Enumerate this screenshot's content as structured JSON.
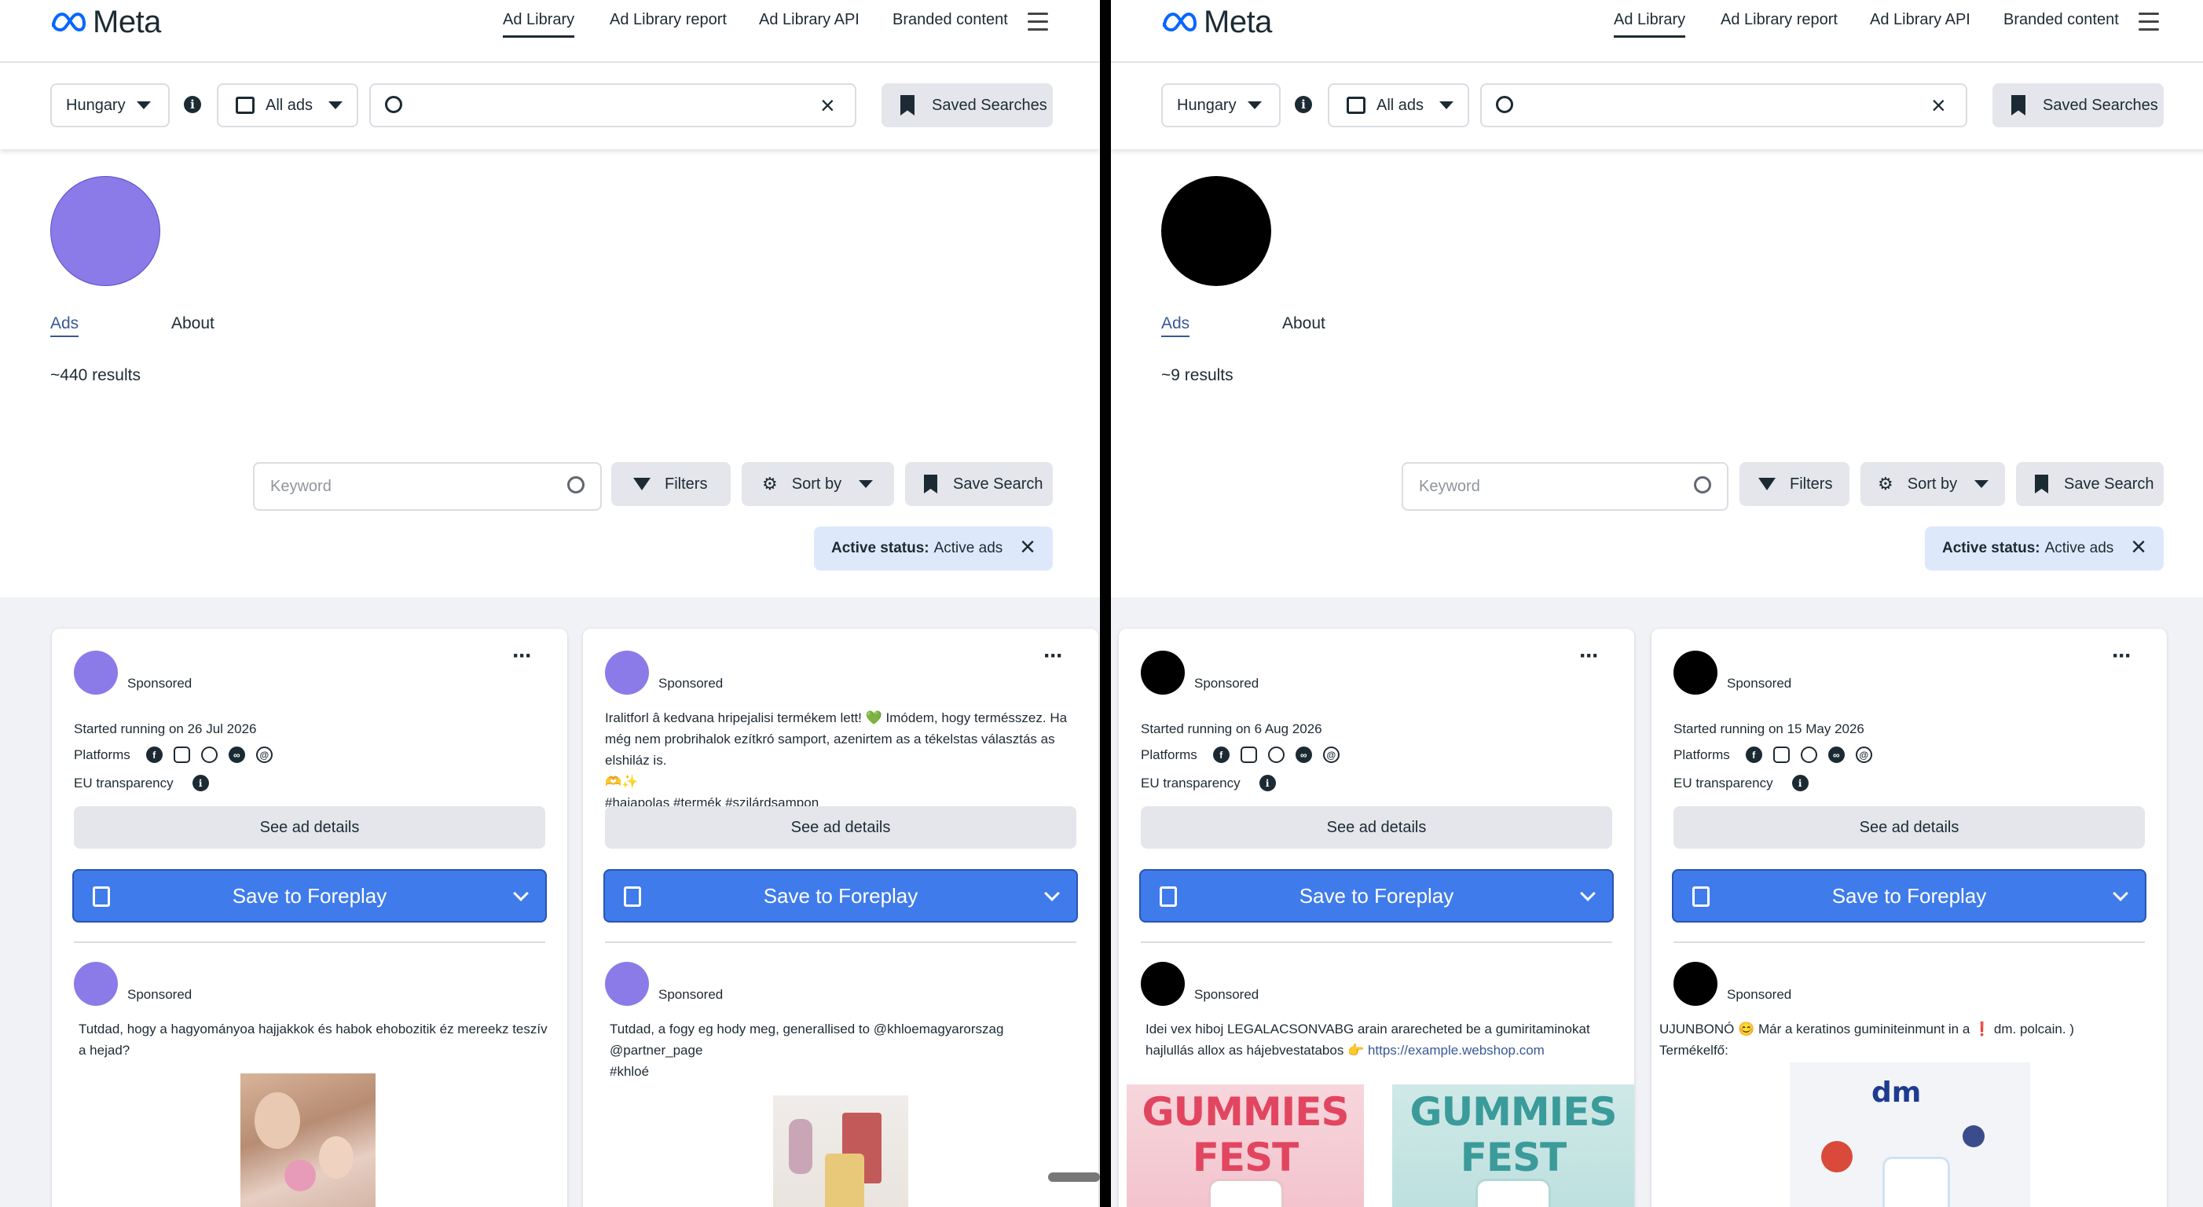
{
  "header": {
    "brand": "Meta",
    "nav": [
      "Ad Library",
      "Ad Library report",
      "Ad Library API",
      "Branded content"
    ]
  },
  "search": {
    "country": "Hungary",
    "ad_type": "All ads",
    "saved_searches": "Saved Searches"
  },
  "tabs": {
    "ads": "Ads",
    "about": "About"
  },
  "toolbar": {
    "keyword_placeholder": "Keyword",
    "filters": "Filters",
    "sort_by": "Sort by",
    "save_search": "Save Search"
  },
  "chip": {
    "label": "Active status:",
    "value": "Active ads"
  },
  "card_common": {
    "sponsored": "Sponsored",
    "platforms": "Platforms",
    "eu": "EU transparency",
    "see_details": "See ad details",
    "foreplay": "Save to Foreplay"
  },
  "colors": {
    "left_avatar": "#8b7be8",
    "right_avatar": "#000000",
    "accent": "#3f7bea"
  },
  "left": {
    "results": "~440 results",
    "cards": [
      {
        "started": "Started running on 26 Jul 2026",
        "second_text": "Tutdad, hogy a hagyományoa hajjakkok és habok ehobozitik éz mereekz teszív a hejad?"
      },
      {
        "top_text_1": "Iralitforl â kedvana hripejalisi termékem lett! 💚 Imódem, hogy termésszez. Ha még nem probrihalok ezítkró samport, azenirtem as a tékelstas választás as elshiláz is.",
        "top_text_2": "🫶✨",
        "top_text_3": "#hajapolas #termék #szilárdsampon",
        "second_text_1": "Tutdad, a fogy eg hody meg, generallised to @khloemagyarorszag",
        "second_text_2": "@partner_page",
        "second_text_3": "#khloé"
      }
    ]
  },
  "right": {
    "results": "~9 results",
    "cards": [
      {
        "started": "Started running on 6 Aug 2026",
        "second_text": "Idei vex hiboj LEGALACSONVABG arain ararecheted be a gumiritaminokat hajlullás allox as hájebvestatabos 👉",
        "link": "https://example.webshop.com",
        "banner": "GUMMIES FEST"
      },
      {
        "started": "Started running on 15 May 2026",
        "second_text": "UJUNBONÓ 😊 Már a keratinos guminiteinmunt in a ❗ dm. polcain. ) Termékelfő:",
        "logo": "dm"
      }
    ]
  }
}
